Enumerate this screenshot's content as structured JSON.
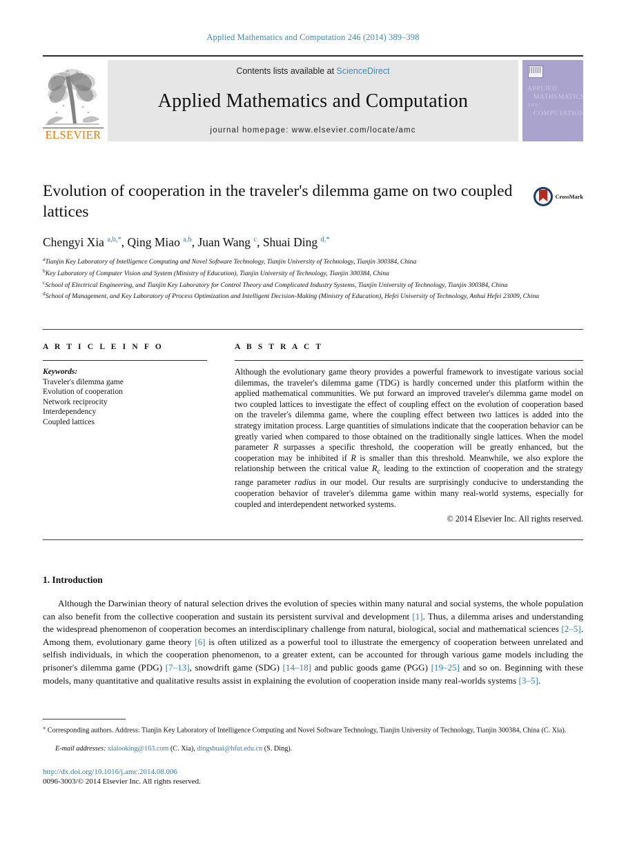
{
  "running_head": "Applied Mathematics and Computation 246 (2014) 389–398",
  "masthead": {
    "publisher_logo_text": "ELSEVIER",
    "contents_prefix": "Contents lists available at ",
    "contents_link": "ScienceDirect",
    "journal_name": "Applied Mathematics and Computation",
    "homepage_line": "journal homepage: www.elsevier.com/locate/amc",
    "cover": {
      "line1": "APPLIED",
      "line2": "MATHEMATICS",
      "line3": "AND",
      "line4": "COMPUTATION"
    }
  },
  "article": {
    "title": "Evolution of cooperation in the traveler's dilemma game on two coupled lattices",
    "crossmark_label": "CrossMark",
    "authors_html": "Chengyi Xia <sup>a,b,</sup><sup>*</sup>, Qing Miao <sup>a,b</sup>, Juan Wang <sup>c</sup>, Shuai Ding <sup>d,</sup><sup>*</sup>",
    "affiliations": [
      {
        "marker": "a",
        "text": "Tianjin Key Laboratory of Intelligence Computing and Novel Software Technology, Tianjin University of Technology, Tianjin 300384, China"
      },
      {
        "marker": "b",
        "text": "Key Laboratory of Computer Vision and System (Ministry of Education), Tianjin University of Technology, Tianjin 300384, China"
      },
      {
        "marker": "c",
        "text": "School of Electrical Engineering, and Tianjin Key Laboratory for Control Theory and Complicated Industry Systems, Tianjin University of Technology, Tianjin 300384, China"
      },
      {
        "marker": "d",
        "text": "School of Management, and Key Laboratory of Process Optimization and Intelligent Decision-Making (Ministry of Education), Hefei University of Technology, Anhui Hefei 23009, China"
      }
    ]
  },
  "article_info": {
    "heading": "A R T I C L E   I N F O",
    "keywords_label": "Keywords:",
    "keywords": [
      "Traveler's dilemma game",
      "Evolution of cooperation",
      "Network reciprocity",
      "Interdependency",
      "Coupled lattices"
    ]
  },
  "abstract": {
    "heading": "A B S T R A C T",
    "text_html": "Although the evolutionary game theory provides a powerful framework to investigate various social dilemmas, the traveler's dilemma game (TDG) is hardly concerned under this platform within the applied mathematical communities. We put forward an improved traveler's dilemma game model on two coupled lattices to investigate the effect of coupling effect on the evolution of cooperation based on the traveler's dilemma game, where the coupling effect between two lattices is added into the strategy imitation process. Large quantities of simulations indicate that the cooperation behavior can be greatly varied when compared to those obtained on the traditionally single lattices. When the model parameter <i>R</i> surpasses a specific threshold, the cooperation will be greatly enhanced, but the cooperation may be inhibited if <i>R</i> is smaller than this threshold. Meanwhile, we also explore the relationship between the critical value <i>R</i><sub>c</sub> leading to the extinction of cooperation and the strategy range parameter <i>radius</i> in our model. Our results are surprisingly conducive to understanding the cooperation behavior of traveler's dilemma game within many real-world systems, especially for coupled and interdependent networked systems.",
    "copyright": "© 2014 Elsevier Inc. All rights reserved."
  },
  "body": {
    "section_title": "1. Introduction",
    "paragraph_html": "Although the Darwinian theory of natural selection drives the evolution of species within many natural and social systems, the whole population can also benefit from the collective cooperation and sustain its persistent survival and development <span class=\"ref\">[1]</span>. Thus, a dilemma arises and understanding the widespread phenomenon of cooperation becomes an interdisciplinary challenge from natural, biological, social and mathematical sciences <span class=\"ref\">[2–5]</span>. Among them, evolutionary game theory <span class=\"ref\">[6]</span> is often utilized as a powerful tool to illustrate the emergency of cooperation between unrelated and selfish individuals, in which the cooperation phenomenon, to a greater extent, can be accounted for through various game models including the prisoner's dilemma game (PDG) <span class=\"ref\">[7–13]</span>, snowdrift game (SDG) <span class=\"ref\">[14–18]</span> and public goods game (PGG) <span class=\"ref\">[19–25]</span> and so on. Beginning with these models, many quantitative and qualitative results assist in explaining the evolution of cooperation inside many real-worlds systems <span class=\"ref\">[3–5]</span>."
  },
  "footer": {
    "corresponding_html": "<sup>⁎</sup> Corresponding authors. Address: Tianjin Key Laboratory of Intelligence Computing and Novel Software Technology, Tianjin University of Technology, Tianjin 300384, China (C. Xia).",
    "email_html": "<i>E-mail addresses:</i> <span class=\"link\">xialooking@163.com</span> (C. Xia), <span class=\"link\">dingshuai@hfut.edu.cn</span> (S. Ding).",
    "doi": "http://dx.doi.org/10.1016/j.amc.2014.08.006",
    "issn_html": "0096-3003/© 2014 Elsevier Inc. All rights reserved."
  },
  "colors": {
    "link_blue": "#2e7faf",
    "sciencedirect_blue": "#3f8cb5",
    "elsevier_orange": "#ec7a08",
    "cover_purple": "#a9a3cd",
    "crossmark_red": "#b52a1c",
    "crossmark_navy": "#1b3a66"
  }
}
